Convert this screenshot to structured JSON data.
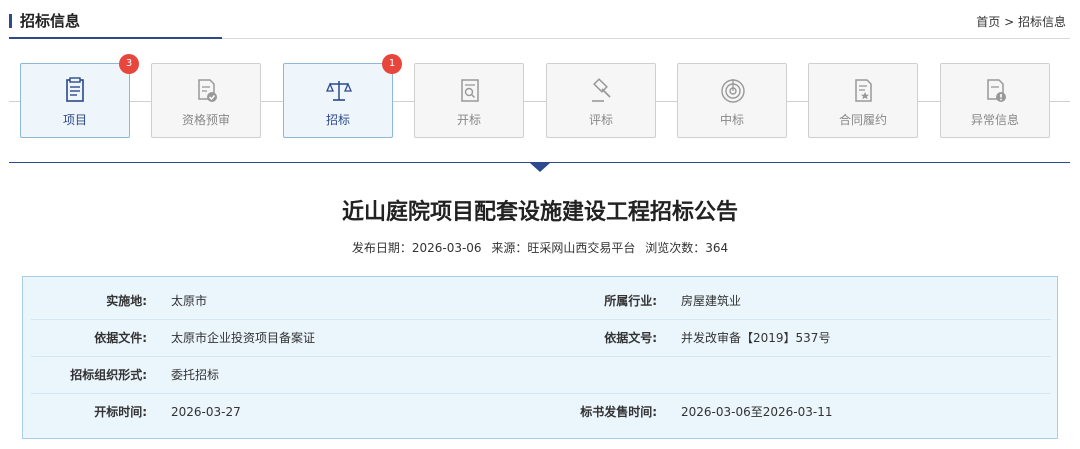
{
  "header": {
    "title": "招标信息",
    "breadcrumb": {
      "home": "首页",
      "separator": ">",
      "current": "招标信息"
    }
  },
  "steps": [
    {
      "label": "项目",
      "icon": "document-list-icon",
      "active": true,
      "badge": "3"
    },
    {
      "label": "资格预审",
      "icon": "document-check-icon",
      "active": false,
      "badge": ""
    },
    {
      "label": "招标",
      "icon": "scales-icon",
      "active": true,
      "badge": "1"
    },
    {
      "label": "开标",
      "icon": "document-search-icon",
      "active": false,
      "badge": ""
    },
    {
      "label": "评标",
      "icon": "gavel-icon",
      "active": false,
      "badge": ""
    },
    {
      "label": "中标",
      "icon": "target-icon",
      "active": false,
      "badge": ""
    },
    {
      "label": "合同履约",
      "icon": "contract-star-icon",
      "active": false,
      "badge": ""
    },
    {
      "label": "异常信息",
      "icon": "document-alert-icon",
      "active": false,
      "badge": ""
    }
  ],
  "notice": {
    "title": "近山庭院项目配套设施建设工程招标公告",
    "publish_date": "发布日期：2026-03-06",
    "source": "来源：旺采网山西交易平台",
    "views": "浏览次数：364"
  },
  "info": {
    "rows": [
      {
        "label1": "实施地:",
        "value1": "太原市",
        "label2": "所属行业:",
        "value2": "房屋建筑业"
      },
      {
        "label1": "依据文件:",
        "value1": "太原市企业投资项目备案证",
        "label2": "依据文号:",
        "value2": "并发改审备【2019】537号"
      },
      {
        "label1": "招标组织形式:",
        "value1": "委托招标",
        "label2": "",
        "value2": ""
      },
      {
        "label1": "开标时间:",
        "value1": "2026-03-27",
        "label2": "标书发售时间:",
        "value2": "2026-03-06至2026-03-11"
      }
    ]
  },
  "colors": {
    "accent": "#2c4a8c",
    "badge": "#e8463c",
    "info_bg": "#eaf5fc",
    "info_border": "#a9cfe6"
  }
}
